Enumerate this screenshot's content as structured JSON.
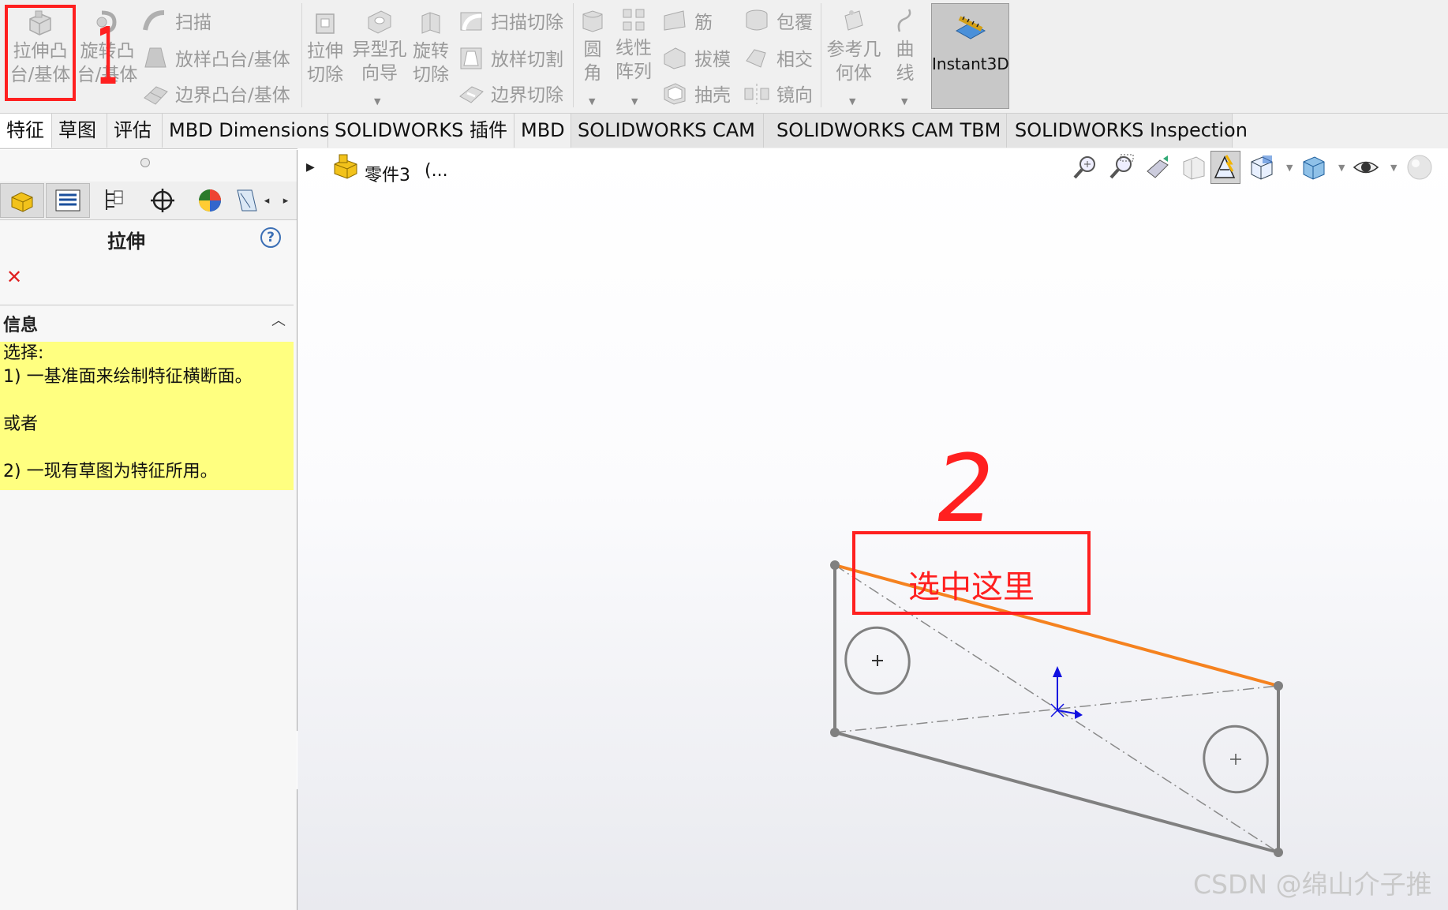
{
  "ribbon": {
    "extrude_boss": {
      "line1": "拉伸凸",
      "line2": "台/基体"
    },
    "revolve_boss": {
      "line1": "旋转凸",
      "line2": "台/基体"
    },
    "sweep": "扫描",
    "loft": "放样凸台/基体",
    "boundary_boss": "边界凸台/基体",
    "extrude_cut": {
      "line1": "拉伸",
      "line2": "切除"
    },
    "hole_wizard": {
      "line1": "异型孔",
      "line2": "向导"
    },
    "revolve_cut": {
      "line1": "旋转",
      "line2": "切除"
    },
    "swept_cut": "扫描切除",
    "lofted_cut": "放样切割",
    "boundary_cut": "边界切除",
    "fillet": {
      "line1": "圆",
      "line2": "角"
    },
    "linear_pattern": {
      "line1": "线性",
      "line2": "阵列"
    },
    "rib": "筋",
    "draft": "拔模",
    "shell": "抽壳",
    "wrap": "包覆",
    "intersect": "相交",
    "mirror": "镜向",
    "ref_geometry": {
      "line1": "参考几",
      "line2": "何体"
    },
    "curves": {
      "line1": "曲",
      "line2": "线"
    },
    "instant3d": "Instant3D"
  },
  "tabs": [
    {
      "label": "特征"
    },
    {
      "label": "草图"
    },
    {
      "label": "评估"
    },
    {
      "label": "MBD Dimensions"
    },
    {
      "label": "SOLIDWORKS 插件"
    },
    {
      "label": "MBD"
    },
    {
      "label": "SOLIDWORKS CAM"
    },
    {
      "label": "SOLIDWORKS CAM TBM"
    },
    {
      "label": "SOLIDWORKS Inspection"
    }
  ],
  "tree": {
    "part_name": "零件3",
    "ellipsis": "(..."
  },
  "property_manager": {
    "title": "拉伸",
    "help_glyph": "?",
    "cancel_glyph": "✕",
    "info_header": "信息",
    "info_lines": [
      "选择:",
      "1) 一基准面来绘制特征横断面。",
      "",
      "或者",
      "",
      "2) 一现有草图为特征所用。"
    ]
  },
  "annotations": {
    "marker1": "1",
    "marker2": "2",
    "select_here": "选中这里"
  },
  "watermark": "CSDN @绵山介子推",
  "colors": {
    "ribbon_bg": "#f0f0f0",
    "info_bg": "#ffff80",
    "annotation_red": "#ff2020",
    "selected_edge": "#f5821f",
    "sketch_gray": "#808080",
    "origin_blue": "#1010e0"
  }
}
